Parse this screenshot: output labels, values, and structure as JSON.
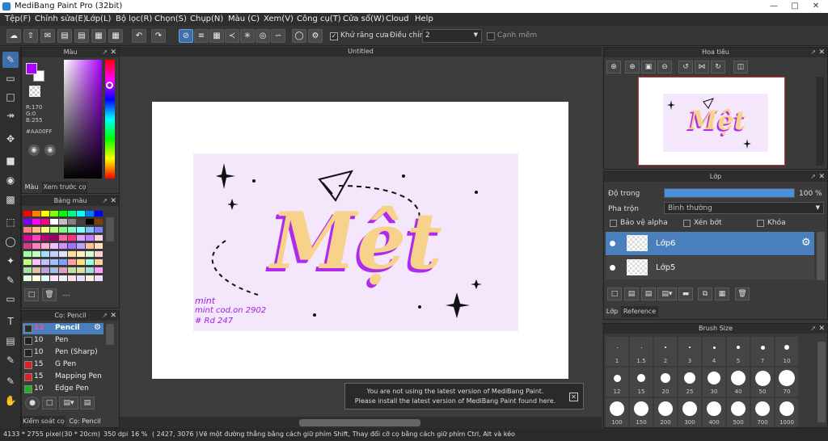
{
  "window": {
    "title": "MediBang Paint Pro (32bit)"
  },
  "menu": [
    "Tệp(F)",
    "Chỉnh sửa(E)",
    "Lớp(L)",
    "Bộ lọc(R)",
    "Chọn(S)",
    "Chụp(N)",
    "Màu (C)",
    "Xem(V)",
    "Công cụ(T)",
    "Cửa sổ(W)",
    "Cloud",
    "Help"
  ],
  "toolbar": {
    "antialias_label": "Khử răng cưa",
    "adjust_label": "Điều chỉnh",
    "adjust_value": "2",
    "soft_edge_label": "Cạnh mềm"
  },
  "color_panel": {
    "title": "Màu",
    "r": "R:170",
    "g": "G:0",
    "b": "B:255",
    "hex": "#AA00FF",
    "tab_color": "Màu",
    "tab_brush_preview": "Xem trước cọ"
  },
  "palette_panel": {
    "title": "Bảng màu",
    "footer_text": "---"
  },
  "brush_panel": {
    "title": "Cọ: Pencil",
    "items": [
      {
        "size": "12",
        "name": "Pencil",
        "color": "#c000ff"
      },
      {
        "size": "10",
        "name": "Pen",
        "color": "#222222"
      },
      {
        "size": "10",
        "name": "Pen (Sharp)",
        "color": "#222222"
      },
      {
        "size": "15",
        "name": "G Pen",
        "color": "#e02020"
      },
      {
        "size": "15",
        "name": "Mapping Pen",
        "color": "#e02020"
      },
      {
        "size": "10",
        "name": "Edge Pen",
        "color": "#20b020"
      }
    ],
    "tab_control": "Kiểm soát cọ",
    "tab_brush": "Cọ: Pencil"
  },
  "canvas": {
    "tab_title": "Untitled",
    "art_word": "Mệt",
    "signature": [
      "mint",
      "mint cod.on 2902",
      "# Rd 247"
    ]
  },
  "notification": {
    "line1": "You are not using the latest version of MediBang Paint.",
    "line2": "Please install the latest version of MediBang Paint found here."
  },
  "navigator": {
    "title": "Hoa tiêu"
  },
  "layer_panel": {
    "title": "Lớp",
    "opacity_label": "Độ trong",
    "opacity_value": "100 %",
    "opacity_level": 1.0,
    "blend_label": "Pha trộn",
    "blend_value": "Bình thường",
    "protect_alpha": "Bảo vệ alpha",
    "clipping": "Xén bớt",
    "lock": "Khóa",
    "layers": [
      "Lớp6",
      "Lớp5"
    ],
    "tab_layer": "Lớp",
    "tab_reference": "Reference"
  },
  "brush_size_panel": {
    "title": "Brush Size",
    "row1": [
      "1",
      "1.5",
      "2",
      "3",
      "4",
      "5",
      "7",
      "10"
    ],
    "row2": [
      "12",
      "15",
      "20",
      "25",
      "30",
      "40",
      "50",
      "70"
    ],
    "row3": [
      "100",
      "150",
      "200",
      "300",
      "400",
      "500",
      "700",
      "1000"
    ]
  },
  "statusbar": {
    "size": "4133 * 2755 pixel",
    "cm": "(30 * 20cm)",
    "dpi": "350 dpi",
    "zoom": "16 %",
    "coords": "( 2427, 3076 )",
    "hint": "Vẽ một đường thẳng bằng cách giữ phím Shift, Thay đổi cỡ cọ bằng cách giữ phím Ctrl, Alt và kéo"
  }
}
